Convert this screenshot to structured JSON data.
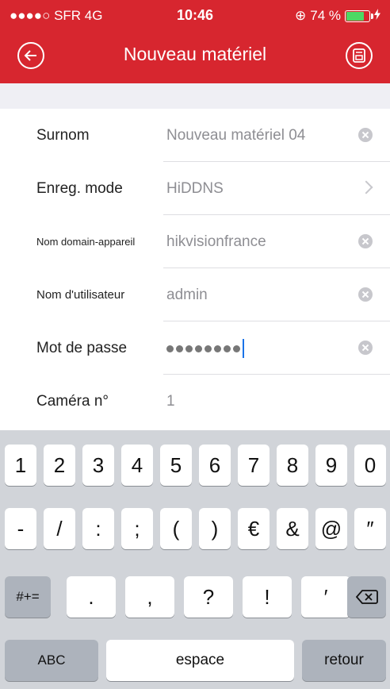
{
  "status_bar": {
    "carrier": "●●●●○ SFR  4G",
    "time": "10:46",
    "battery": "74 %",
    "battery_level": 0.74,
    "battery_color": "#4cd964",
    "lock_icon": "⊕"
  },
  "header": {
    "title": "Nouveau matériel",
    "bg_color": "#d7262f"
  },
  "form": {
    "rows": [
      {
        "label": "Surnom",
        "value": "Nouveau matériel 04"
      },
      {
        "label": "Enreg. mode",
        "value": "HiDDNS"
      },
      {
        "label": "Nom domain-appareil",
        "value": "hikvisionfrance"
      },
      {
        "label": "Nom d'utilisateur",
        "value": "admin"
      },
      {
        "label": "Mot de passe",
        "value": ""
      },
      {
        "label": "Caméra n°",
        "value": "1"
      }
    ]
  },
  "keyboard": {
    "row1": [
      "1",
      "2",
      "3",
      "4",
      "5",
      "6",
      "7",
      "8",
      "9",
      "0"
    ],
    "row2": [
      "-",
      "/",
      ":",
      ";",
      "(",
      ")",
      "€",
      "&",
      "@",
      "″"
    ],
    "row3": [
      ".",
      ",",
      "?",
      "!",
      "′"
    ],
    "shift_label": "#+=",
    "abc_label": "ABC",
    "space_label": "espace",
    "return_label": "retour"
  }
}
